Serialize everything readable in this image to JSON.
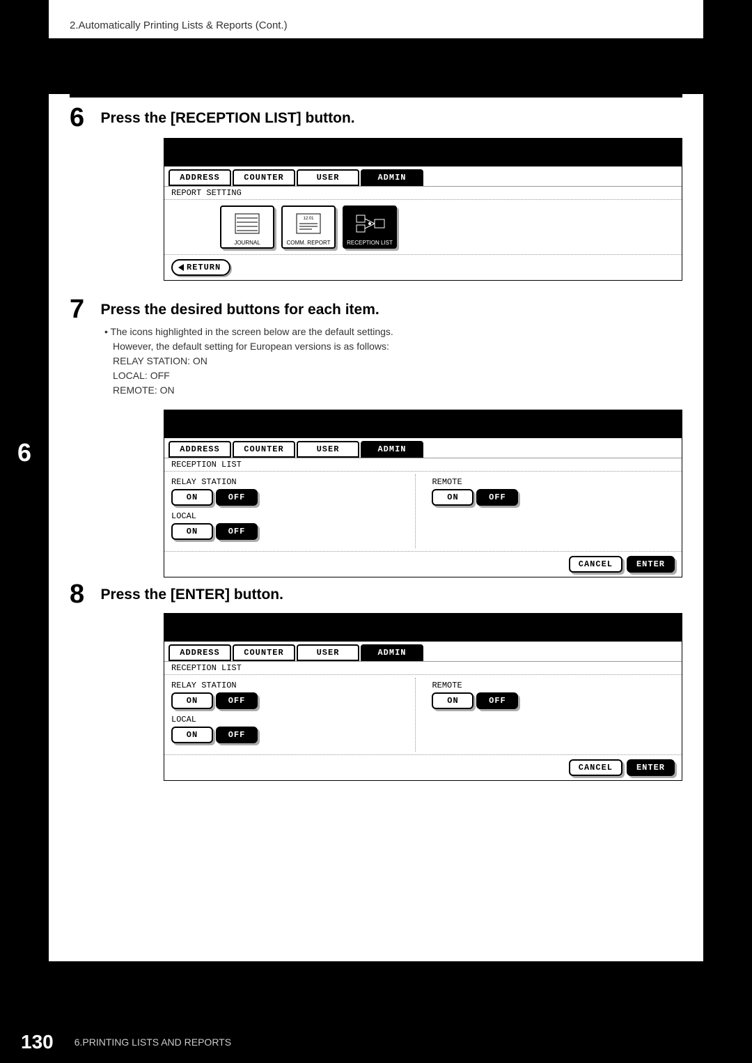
{
  "header": {
    "breadcrumb": "2.Automatically Printing Lists & Reports (Cont.)"
  },
  "chapter": {
    "number": "6"
  },
  "footer": {
    "page_number": "130",
    "caption": "6.PRINTING LISTS AND REPORTS"
  },
  "steps": {
    "step6": {
      "num": "6",
      "title": "Press the [RECEPTION LIST] button."
    },
    "step7": {
      "num": "7",
      "title": "Press the desired buttons for each item.",
      "note_line1": "The icons highlighted in the screen below are the default settings.",
      "note_line2": "However, the default setting for European versions is as follows:",
      "note_line3": "RELAY STATION: ON",
      "note_line4": "LOCAL: OFF",
      "note_line5": "REMOTE: ON"
    },
    "step8": {
      "num": "8",
      "title": "Press the [ENTER] button."
    }
  },
  "screen1": {
    "tabs": {
      "t1": "ADDRESS",
      "t2": "COUNTER",
      "t3": "USER",
      "t4": "ADMIN"
    },
    "subheading": "REPORT SETTING",
    "icons": {
      "journal": "JOURNAL",
      "comm": "COMM. REPORT",
      "reception": "RECEPTION LIST"
    },
    "return": "RETURN"
  },
  "screen2": {
    "tabs": {
      "t1": "ADDRESS",
      "t2": "COUNTER",
      "t3": "USER",
      "t4": "ADMIN"
    },
    "subheading": "RECEPTION LIST",
    "relay": {
      "label": "RELAY STATION",
      "on": "ON",
      "off": "OFF"
    },
    "local": {
      "label": "LOCAL",
      "on": "ON",
      "off": "OFF"
    },
    "remote": {
      "label": "REMOTE",
      "on": "ON",
      "off": "OFF"
    },
    "cancel": "CANCEL",
    "enter": "ENTER"
  },
  "screen3": {
    "tabs": {
      "t1": "ADDRESS",
      "t2": "COUNTER",
      "t3": "USER",
      "t4": "ADMIN"
    },
    "subheading": "RECEPTION LIST",
    "relay": {
      "label": "RELAY STATION",
      "on": "ON",
      "off": "OFF"
    },
    "local": {
      "label": "LOCAL",
      "on": "ON",
      "off": "OFF"
    },
    "remote": {
      "label": "REMOTE",
      "on": "ON",
      "off": "OFF"
    },
    "cancel": "CANCEL",
    "enter": "ENTER"
  }
}
